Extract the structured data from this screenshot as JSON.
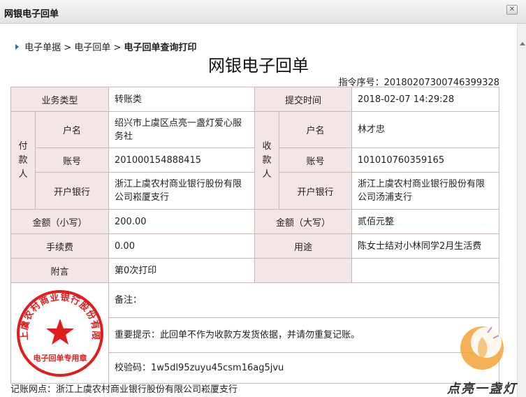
{
  "window": {
    "title": "网银电子回单"
  },
  "breadcrumb": {
    "items": [
      "电子单据",
      "电子回单"
    ],
    "current": "电子回单查询打印",
    "separator": ">"
  },
  "receipt": {
    "title": "网银电子回单",
    "order_number": "指令序号：20180207300746399328",
    "business_type_label": "业务类型",
    "business_type": "转账类",
    "submit_time_label": "提交时间",
    "submit_time": "2018-02-07 14:29:28",
    "payer": {
      "group_label": "付款人",
      "name_label": "户名",
      "name": "绍兴市上虞区点亮一盏灯爱心服务社",
      "account_label": "账号",
      "account": "201000154888415",
      "bank_label": "开户银行",
      "bank": "浙江上虞农村商业银行股份有限公司崧厦支行"
    },
    "payee": {
      "group_label": "收款人",
      "name_label": "户名",
      "name": "林才忠",
      "account_label": "账号",
      "account": "101010760359165",
      "bank_label": "开户银行",
      "bank": "浙江上虞农村商业银行股份有限公司汤浦支行"
    },
    "amount_small_label": "金额（小写）",
    "amount_small": "200.00",
    "amount_big_label": "金额（大写）",
    "amount_big": "贰佰元整",
    "fee_label": "手续费",
    "fee": "0.00",
    "purpose_label": "用途",
    "purpose": "陈女士结对小林同学2月生活费",
    "remark_label": "附言",
    "remark": "第0次打印",
    "note": "备注：",
    "notice": "重要提示：此回单不作为收款方发货依据，并请勿重复记账。",
    "checksum": "校验码：1w5dl95zuyu45csm16ag5jvu",
    "footer": "记账网点：浙江上虞农村商业银行股份有限公司崧厦支行"
  },
  "seal": {
    "ring_text": "浙江上虞农村商业银行股份有限公司",
    "bottom_text": "电子回单专用章",
    "color": "#e01e1e"
  },
  "watermark": {
    "text": "点亮一盏灯",
    "colors": {
      "orange": "#f2a33a",
      "dark": "#333333"
    }
  }
}
